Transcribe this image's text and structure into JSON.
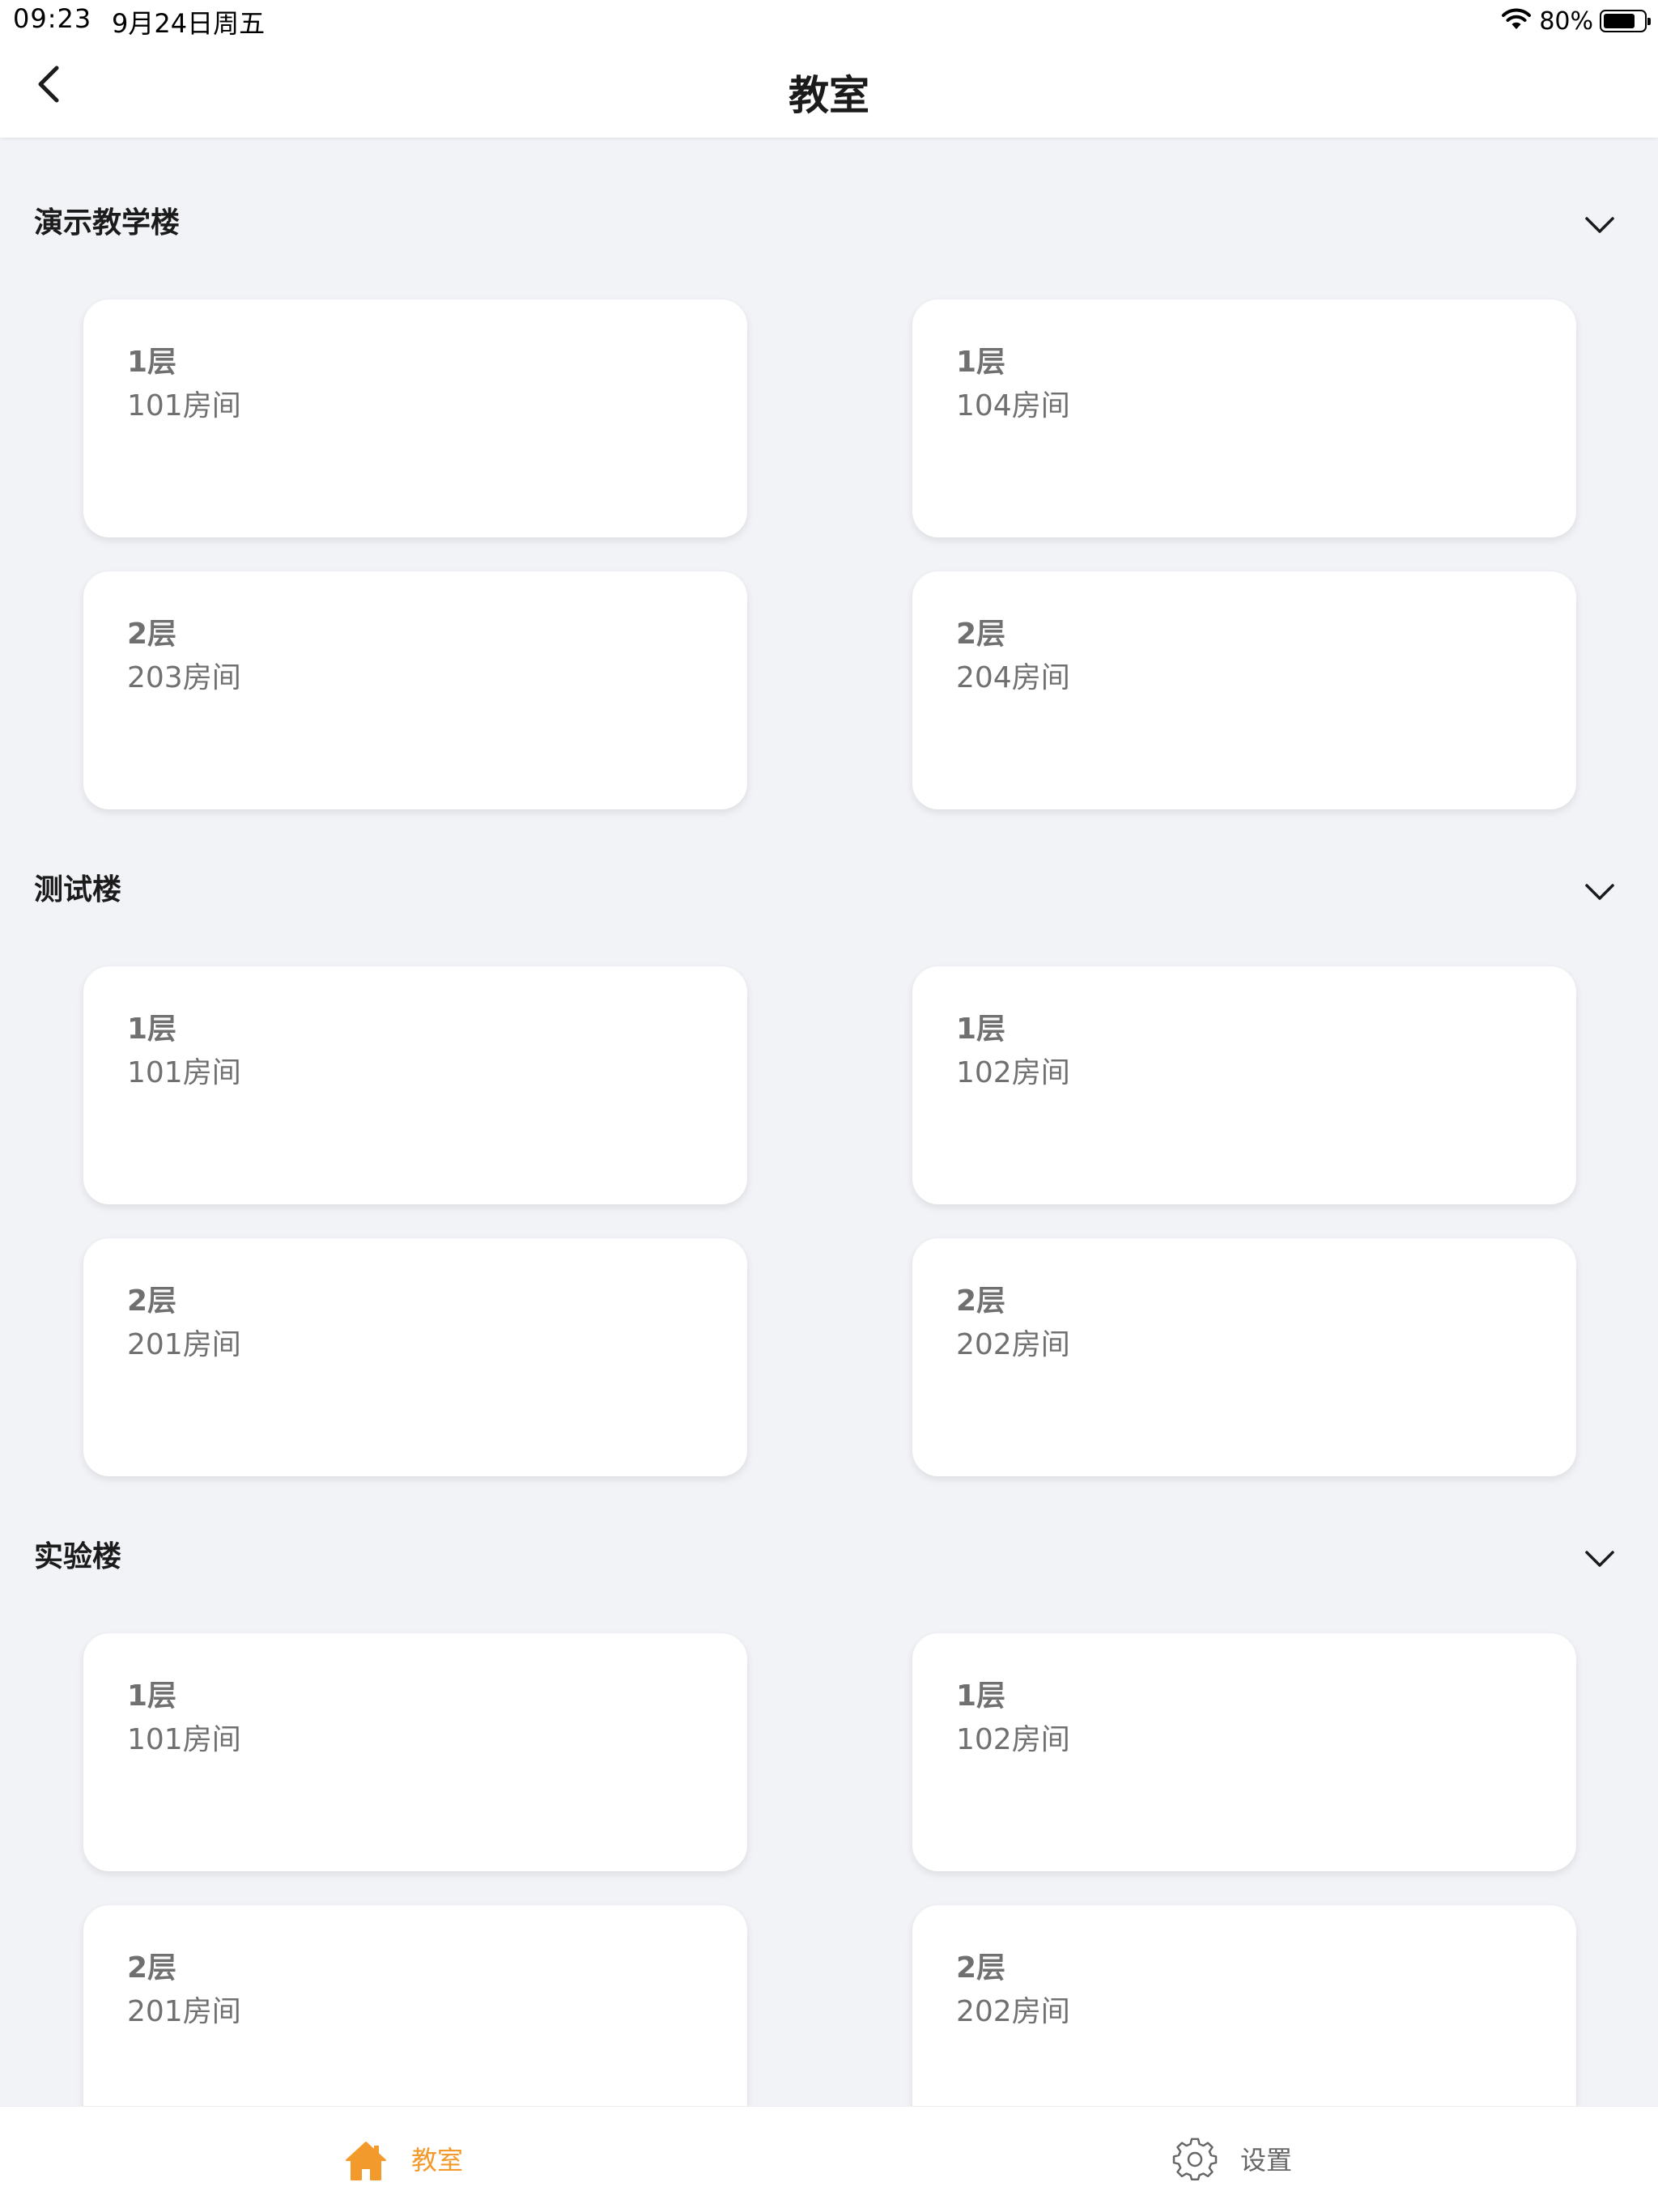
{
  "status_bar": {
    "time": "09:23",
    "date": "9月24日周五",
    "battery_percent": "80%",
    "battery_level": 0.8
  },
  "nav": {
    "title": "教室"
  },
  "sections": [
    {
      "title": "演示教学楼",
      "rooms": [
        {
          "floor": "1层",
          "room": "101房间"
        },
        {
          "floor": "1层",
          "room": "104房间"
        },
        {
          "floor": "2层",
          "room": "203房间"
        },
        {
          "floor": "2层",
          "room": "204房间"
        }
      ]
    },
    {
      "title": "测试楼",
      "rooms": [
        {
          "floor": "1层",
          "room": "101房间"
        },
        {
          "floor": "1层",
          "room": "102房间"
        },
        {
          "floor": "2层",
          "room": "201房间"
        },
        {
          "floor": "2层",
          "room": "202房间"
        }
      ]
    },
    {
      "title": "实验楼",
      "rooms": [
        {
          "floor": "1层",
          "room": "101房间"
        },
        {
          "floor": "1层",
          "room": "102房间"
        },
        {
          "floor": "2层",
          "room": "201房间"
        },
        {
          "floor": "2层",
          "room": "202房间"
        }
      ]
    }
  ],
  "tab_bar": {
    "tabs": [
      {
        "label": "教室",
        "icon": "home-icon",
        "active": true
      },
      {
        "label": "设置",
        "icon": "gear-icon",
        "active": false
      }
    ]
  },
  "colors": {
    "accent": "#F39A2C",
    "background": "#F2F3F7",
    "card": "#FFFFFF",
    "text_secondary": "#707070"
  }
}
